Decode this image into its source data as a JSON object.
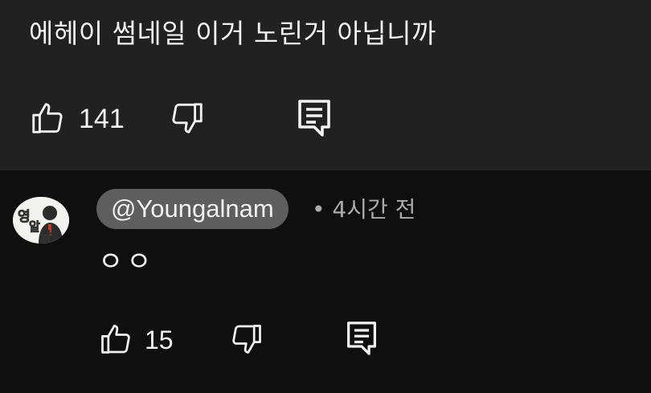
{
  "parent_comment": {
    "text": "에헤이 썸네일 이거 노린거 아닙니까",
    "like_count": "141",
    "icons": {
      "like": "thumbs-up-icon",
      "dislike": "thumbs-down-icon",
      "reply": "comment-reply-icon"
    }
  },
  "reply_comment": {
    "author": "@Youngalnam",
    "meta": "• 4시간 전",
    "text": "ㅇㅇ",
    "like_count": "15",
    "avatar_text": "영알남",
    "icons": {
      "like": "thumbs-up-icon",
      "dislike": "thumbs-down-icon",
      "reply": "comment-reply-icon"
    }
  },
  "colors": {
    "parent_background": "#212121",
    "page_background": "#0f0f0f",
    "author_chip": "#5e5e5e",
    "secondary_text": "#aaaaaa",
    "primary_text": "#f1f1f1",
    "avatar_accent": "#f5c400"
  }
}
